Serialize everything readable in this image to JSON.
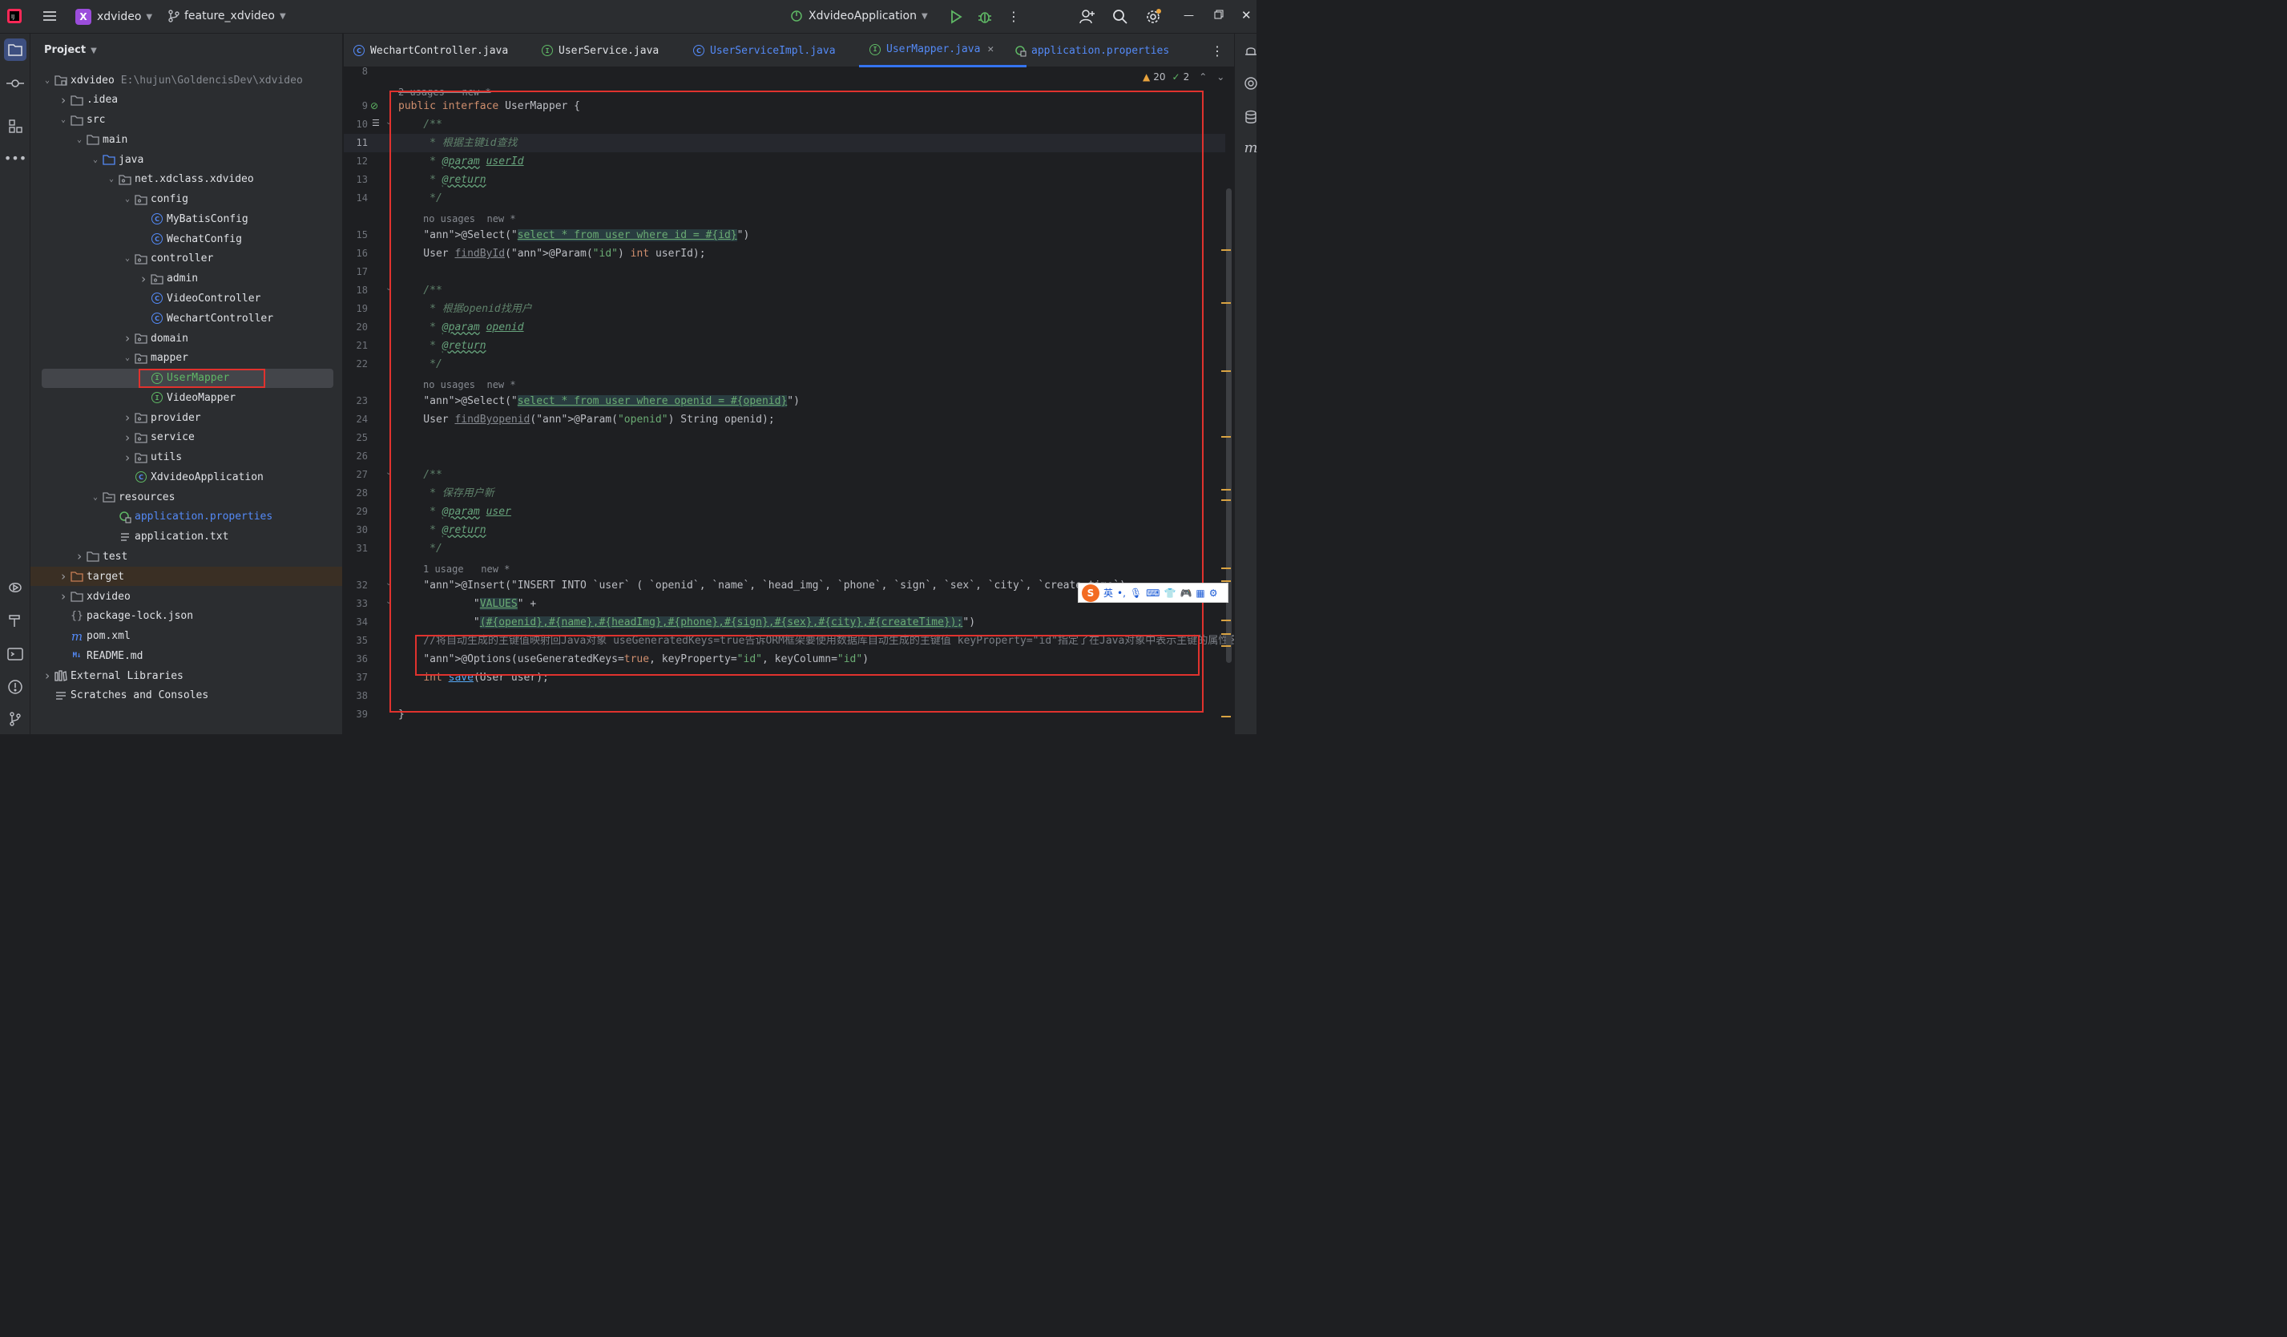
{
  "titlebar": {
    "project_badge": "X",
    "project": "xdvideo",
    "branch": "feature_xdvideo",
    "run_config": "XdvideoApplication"
  },
  "project_panel": {
    "title": "Project",
    "root_path": "E:\\hujun\\GoldencisDev\\xdvideo",
    "tree": [
      {
        "label": "xdvideo",
        "arrow": "v",
        "icon": "module"
      },
      {
        "label": ".idea",
        "arrow": ">",
        "icon": "folder"
      },
      {
        "label": "src",
        "arrow": "v",
        "icon": "folder"
      },
      {
        "label": "main",
        "arrow": "v",
        "icon": "folder"
      },
      {
        "label": "java",
        "arrow": "v",
        "icon": "src-folder"
      },
      {
        "label": "net.xdclass.xdvideo",
        "arrow": "v",
        "icon": "package"
      },
      {
        "label": "config",
        "arrow": "v",
        "icon": "package"
      },
      {
        "label": "MyBatisConfig",
        "arrow": "",
        "icon": "class"
      },
      {
        "label": "WechatConfig",
        "arrow": "",
        "icon": "class"
      },
      {
        "label": "controller",
        "arrow": "v",
        "icon": "package"
      },
      {
        "label": "admin",
        "arrow": ">",
        "icon": "package"
      },
      {
        "label": "VideoController",
        "arrow": "",
        "icon": "class"
      },
      {
        "label": "WechartController",
        "arrow": "",
        "icon": "class"
      },
      {
        "label": "domain",
        "arrow": ">",
        "icon": "package"
      },
      {
        "label": "mapper",
        "arrow": "v",
        "icon": "package"
      },
      {
        "label": "UserMapper",
        "arrow": "",
        "icon": "interface"
      },
      {
        "label": "VideoMapper",
        "arrow": "",
        "icon": "interface"
      },
      {
        "label": "provider",
        "arrow": ">",
        "icon": "package"
      },
      {
        "label": "service",
        "arrow": ">",
        "icon": "package"
      },
      {
        "label": "utils",
        "arrow": ">",
        "icon": "package"
      },
      {
        "label": "XdvideoApplication",
        "arrow": "",
        "icon": "spring-class"
      },
      {
        "label": "resources",
        "arrow": "v",
        "icon": "res-folder"
      },
      {
        "label": "application.properties",
        "arrow": "",
        "icon": "properties"
      },
      {
        "label": "application.txt",
        "arrow": "",
        "icon": "text"
      },
      {
        "label": "test",
        "arrow": ">",
        "icon": "folder"
      },
      {
        "label": "target",
        "arrow": ">",
        "icon": "folder-excluded"
      },
      {
        "label": "xdvideo",
        "arrow": ">",
        "icon": "folder"
      },
      {
        "label": "package-lock.json",
        "arrow": "",
        "icon": "json"
      },
      {
        "label": "pom.xml",
        "arrow": "",
        "icon": "maven"
      },
      {
        "label": "README.md",
        "arrow": "",
        "icon": "markdown"
      },
      {
        "label": "External Libraries",
        "arrow": ">",
        "icon": "libraries"
      },
      {
        "label": "Scratches and Consoles",
        "arrow": "",
        "icon": "scratches"
      }
    ]
  },
  "tabs": [
    {
      "label": "WechartController.java",
      "icon": "class"
    },
    {
      "label": "UserService.java",
      "icon": "interface"
    },
    {
      "label": "UserServiceImpl.java",
      "icon": "class"
    },
    {
      "label": "UserMapper.java",
      "icon": "interface",
      "active": true
    },
    {
      "label": "application.properties",
      "icon": "properties"
    }
  ],
  "inspections": {
    "warnings": "20",
    "checks": "2"
  },
  "editor": {
    "inlay_top": "2 usages   new *",
    "lines": {
      "8": "",
      "9": "public interface UserMapper {",
      "10": "    /**",
      "11": "     * 根据主键id查找",
      "12": "     * @param userId",
      "13": "     * @return",
      "14": "     */",
      "hint1": "no usages  new *",
      "15": "    @Select(\"select * from user where id = #{id}\")",
      "16": "    User findById(@Param(\"id\") int userId);",
      "17": "",
      "18": "    /**",
      "19": "     * 根据openid找用户",
      "20": "     * @param openid",
      "21": "     * @return",
      "22": "     */",
      "hint2": "no usages  new *",
      "23": "    @Select(\"select * from user where openid = #{openid}\")",
      "24": "    User findByopenid(@Param(\"openid\") String openid);",
      "25": "",
      "26": "",
      "27": "    /**",
      "28": "     * 保存用户新",
      "29": "     * @param user",
      "30": "     * @return",
      "31": "     */",
      "hint3": "1 usage   new *",
      "32": "    @Insert(\"INSERT INTO `user` ( `openid`, `name`, `head_img`, `phone`, `sign`, `sex`, `city`, `create_time`)",
      "33": "            \"VALUES\" +",
      "34": "            \"(#{openid},#{name},#{headImg},#{phone},#{sign},#{sex},#{city},#{createTime});\")",
      "35": "    //将自动生成的主键值映射回Java对象 useGeneratedKeys=true告诉ORM框架要使用数据库自动生成的主键值 keyProperty=\"id\"指定了在Java对象中表示主键的属性名",
      "36": "    @Options(useGeneratedKeys=true, keyProperty=\"id\", keyColumn=\"id\")",
      "37": "    int save(User user);",
      "38": "",
      "39": "}"
    }
  },
  "ime_toolbar": {
    "lang": "英"
  },
  "colors": {
    "accent": "#3574f0",
    "highlight_box": "#e0322e"
  }
}
